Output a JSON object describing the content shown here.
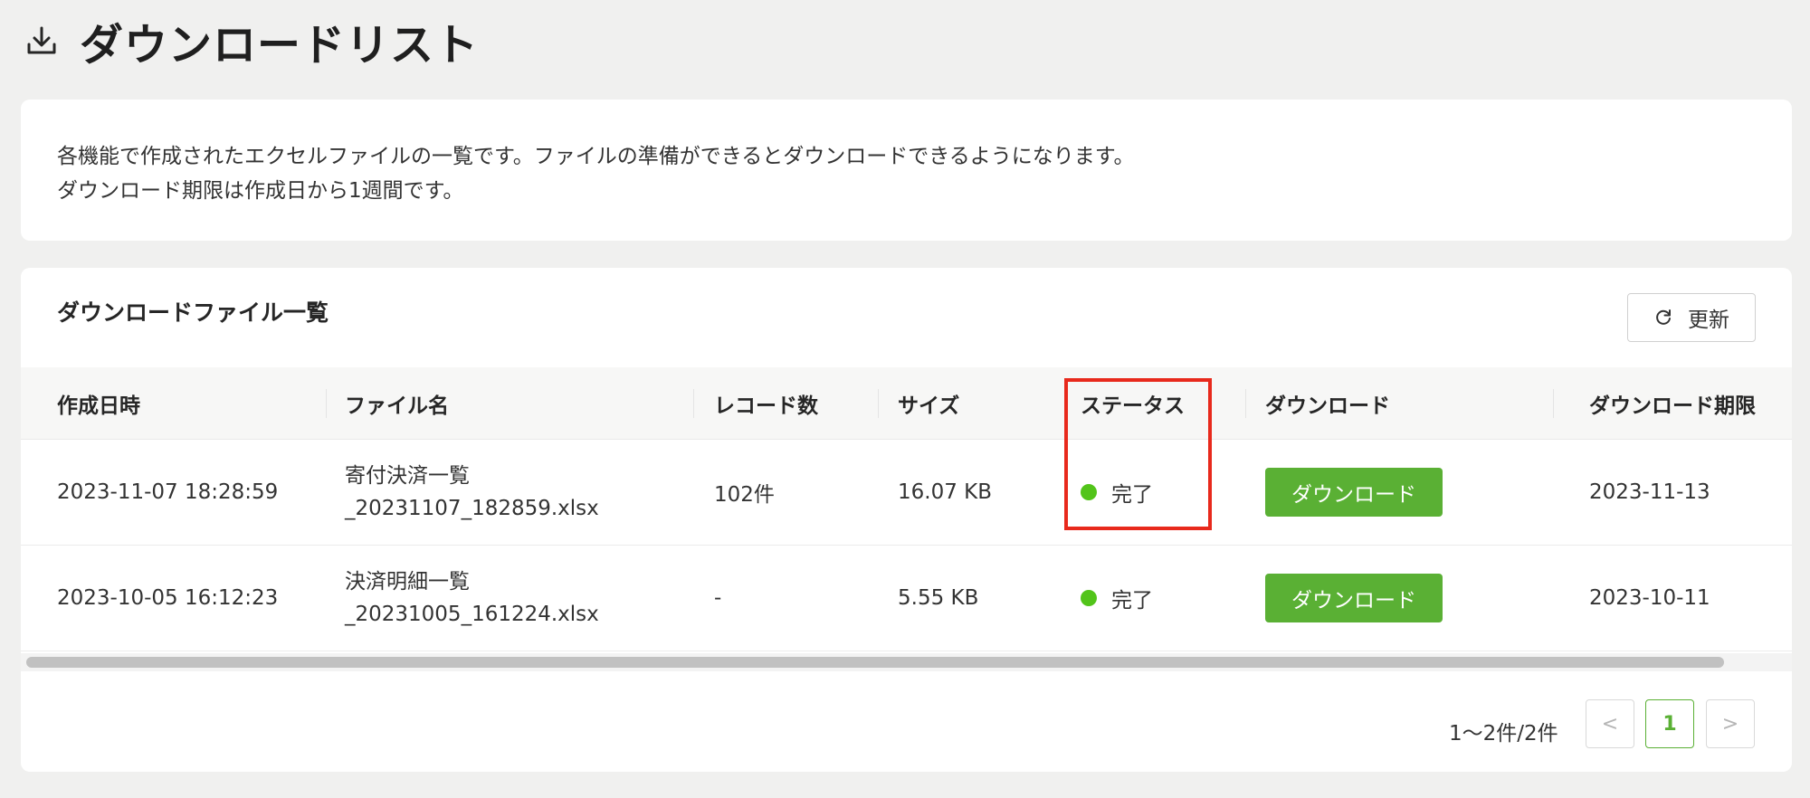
{
  "header": {
    "title": "ダウンロードリスト",
    "icon": "download-icon"
  },
  "info": {
    "lines": [
      "各機能で作成されたエクセルファイルの一覧です。ファイルの準備ができるとダウンロードできるようになります。",
      "ダウンロード期限は作成日から1週間です。"
    ]
  },
  "list": {
    "title": "ダウンロードファイル一覧",
    "refresh_label": "更新",
    "refresh_icon": "reload-icon",
    "columns": [
      "作成日時",
      "ファイル名",
      "レコード数",
      "サイズ",
      "ステータス",
      "ダウンロード",
      "ダウンロード期限"
    ],
    "rows": [
      {
        "created_at": "2023-11-07 18:28:59",
        "file_name_1": "寄付決済一覧",
        "file_name_2": "_20231107_182859.xlsx",
        "records": "102件",
        "size": "16.07 KB",
        "status": "完了",
        "download_label": "ダウンロード",
        "expires": "2023-11-13"
      },
      {
        "created_at": "2023-10-05 16:12:23",
        "file_name_1": "決済明細一覧",
        "file_name_2": "_20231005_161224.xlsx",
        "records": "-",
        "size": "5.55 KB",
        "status": "完了",
        "download_label": "ダウンロード",
        "expires": "2023-10-11"
      }
    ]
  },
  "pagination": {
    "summary": "1〜2件/2件",
    "prev": "<",
    "current": "1",
    "next": ">"
  },
  "colors": {
    "accent": "#5ab034",
    "status_complete": "#52c41a",
    "highlight": "#e8291c"
  }
}
